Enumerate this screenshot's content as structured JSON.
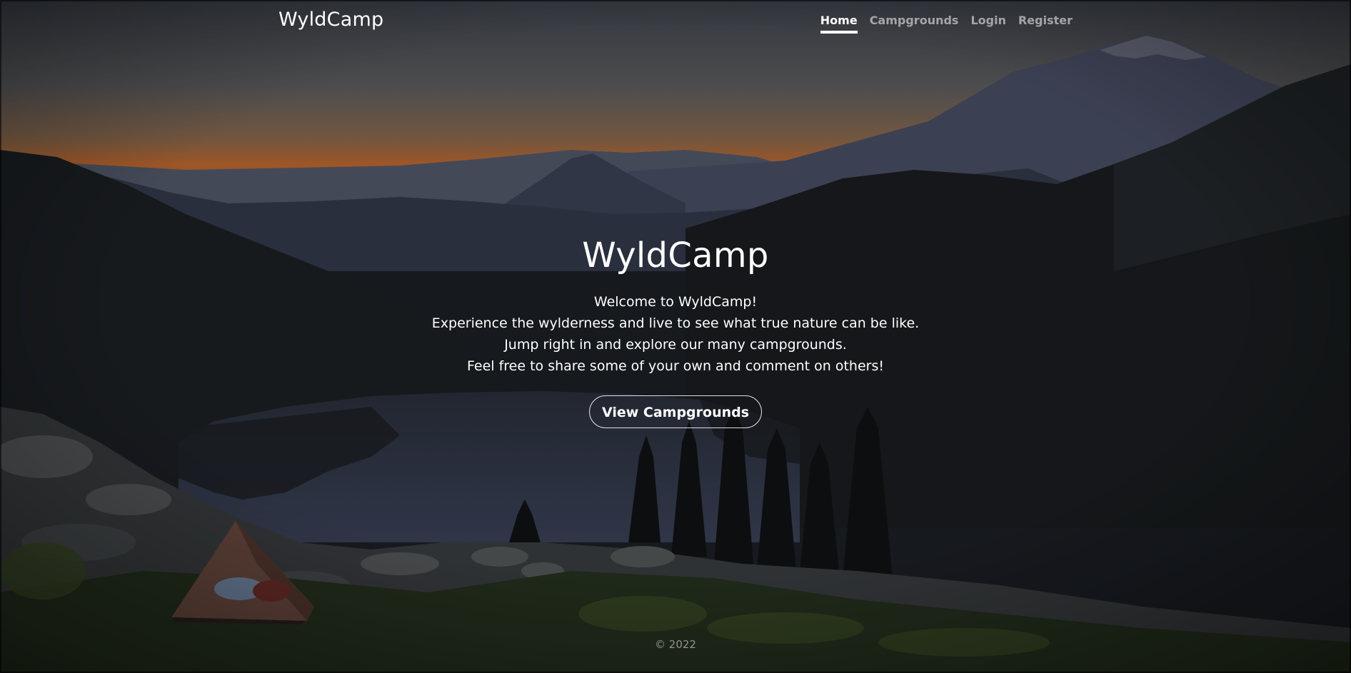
{
  "header": {
    "brand": "WyldCamp",
    "nav": [
      {
        "label": "Home",
        "active": true
      },
      {
        "label": "Campgrounds",
        "active": false
      },
      {
        "label": "Login",
        "active": false
      },
      {
        "label": "Register",
        "active": false
      }
    ]
  },
  "hero": {
    "title": "WyldCamp",
    "lines": [
      "Welcome to WyldCamp!",
      "Experience the wylderness and live to see what true nature can be like.",
      "Jump right in and explore our many campgrounds.",
      "Feel free to share some of your own and comment on others!"
    ],
    "button_label": "View Campgrounds"
  },
  "footer": {
    "copyright": "© 2022"
  },
  "colors": {
    "text": "#ffffff",
    "nav_inactive": "rgba(255,255,255,0.55)",
    "sky_top": "#4a4f58",
    "sunset": "#c76a2e",
    "forest": "#15191c"
  },
  "background": {
    "subject": "mountain-lake-camp-scene-image"
  }
}
